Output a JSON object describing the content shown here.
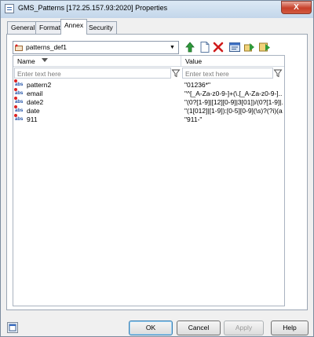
{
  "window": {
    "title": "GMS_Patterns [172.25.157.93:2020] Properties",
    "close_label": "X"
  },
  "tabs": [
    {
      "label": "General"
    },
    {
      "label": "Format"
    },
    {
      "label": "Annex"
    },
    {
      "label": "Security"
    }
  ],
  "active_tab": "Annex",
  "annex": {
    "dropdown": {
      "value": "patterns_def1"
    },
    "toolbar": [
      "up-arrow-icon",
      "new-page-icon",
      "delete-icon",
      "edit-icon",
      "import-icon",
      "export-icon"
    ],
    "columns": {
      "name": "Name",
      "value": "Value"
    },
    "filter_placeholder": "Enter text here",
    "rows": [
      {
        "name": "pattern2",
        "value": "\"01236*\""
      },
      {
        "name": "email",
        "value": "\"^[_A-Za-z0-9-]+(\\.[_A-Za-z0-9-]..."
      },
      {
        "name": "date2",
        "value": "\"(0?[1-9]|[12][0-9]|3[01])/(0?[1-9]|..."
      },
      {
        "name": "date",
        "value": "\"(1[012]|[1-9]):[0-5][0-9](\\s)?(?i)(a..."
      },
      {
        "name": "911",
        "value": "\"911-\""
      }
    ],
    "row_icon_text": "abs"
  },
  "buttons": {
    "ok": "OK",
    "cancel": "Cancel",
    "apply": "Apply",
    "help": "Help"
  }
}
